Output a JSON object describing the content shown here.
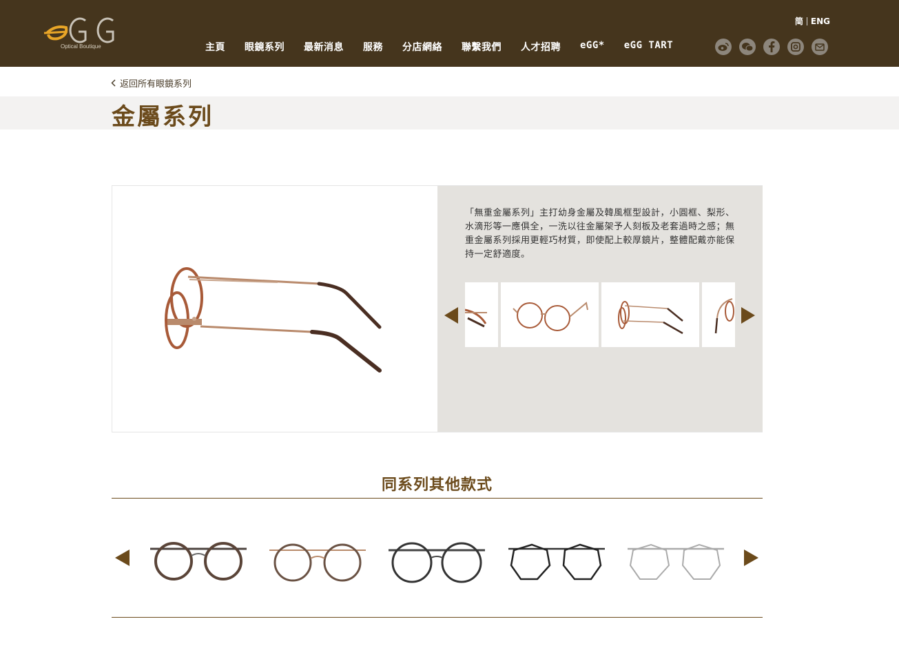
{
  "header": {
    "logo_text": "eGG",
    "logo_sub": "Optical Boutique",
    "lang": [
      "简",
      "ENG"
    ],
    "nav": [
      "主頁",
      "眼鏡系列",
      "最新消息",
      "服務",
      "分店網絡",
      "聯繫我們",
      "人才招聘",
      "eGG*",
      "eGG TART"
    ],
    "social": [
      "weibo-icon",
      "wechat-icon",
      "facebook-icon",
      "instagram-icon",
      "email-icon"
    ]
  },
  "back_link": "返回所有眼鏡系列",
  "page_title": "金屬系列",
  "product": {
    "description": "「無重金屬系列」主打幼身金屬及韓風框型設計，小圓框、梨形、水滴形等一應俱全，一洗以往金屬架予人刻板及老套過時之感；無重金屬系列採用更輕巧材質，即使配上較厚鏡片，整體配戴亦能保持一定舒適度。"
  },
  "related": {
    "title": "同系列其他款式"
  },
  "colors": {
    "header_bg": "#45351d",
    "accent": "#6b4a1b",
    "info_bg": "#e4e2de",
    "title_band": "#f3f2f1"
  }
}
